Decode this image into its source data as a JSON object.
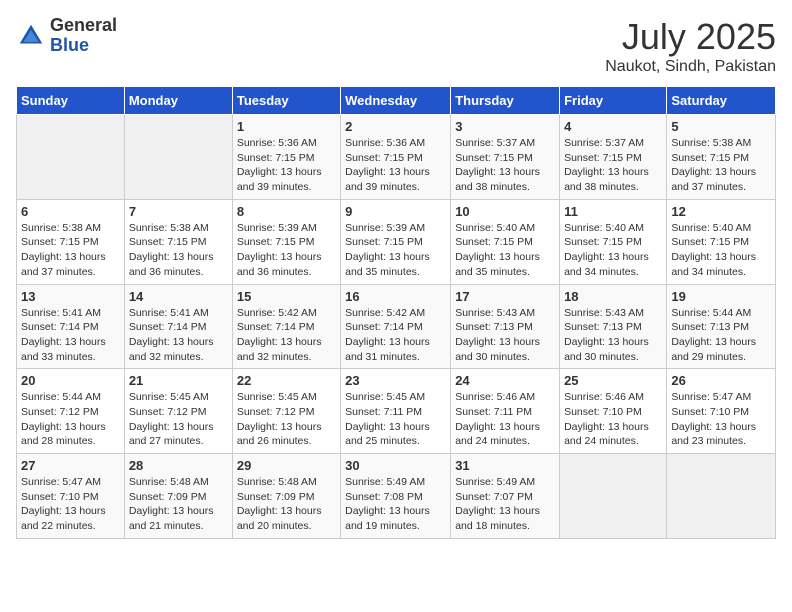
{
  "header": {
    "logo_general": "General",
    "logo_blue": "Blue",
    "month_year": "July 2025",
    "location": "Naukot, Sindh, Pakistan"
  },
  "days_of_week": [
    "Sunday",
    "Monday",
    "Tuesday",
    "Wednesday",
    "Thursday",
    "Friday",
    "Saturday"
  ],
  "weeks": [
    [
      {
        "day": "",
        "info": ""
      },
      {
        "day": "",
        "info": ""
      },
      {
        "day": "1",
        "info": "Sunrise: 5:36 AM\nSunset: 7:15 PM\nDaylight: 13 hours and 39 minutes."
      },
      {
        "day": "2",
        "info": "Sunrise: 5:36 AM\nSunset: 7:15 PM\nDaylight: 13 hours and 39 minutes."
      },
      {
        "day": "3",
        "info": "Sunrise: 5:37 AM\nSunset: 7:15 PM\nDaylight: 13 hours and 38 minutes."
      },
      {
        "day": "4",
        "info": "Sunrise: 5:37 AM\nSunset: 7:15 PM\nDaylight: 13 hours and 38 minutes."
      },
      {
        "day": "5",
        "info": "Sunrise: 5:38 AM\nSunset: 7:15 PM\nDaylight: 13 hours and 37 minutes."
      }
    ],
    [
      {
        "day": "6",
        "info": "Sunrise: 5:38 AM\nSunset: 7:15 PM\nDaylight: 13 hours and 37 minutes."
      },
      {
        "day": "7",
        "info": "Sunrise: 5:38 AM\nSunset: 7:15 PM\nDaylight: 13 hours and 36 minutes."
      },
      {
        "day": "8",
        "info": "Sunrise: 5:39 AM\nSunset: 7:15 PM\nDaylight: 13 hours and 36 minutes."
      },
      {
        "day": "9",
        "info": "Sunrise: 5:39 AM\nSunset: 7:15 PM\nDaylight: 13 hours and 35 minutes."
      },
      {
        "day": "10",
        "info": "Sunrise: 5:40 AM\nSunset: 7:15 PM\nDaylight: 13 hours and 35 minutes."
      },
      {
        "day": "11",
        "info": "Sunrise: 5:40 AM\nSunset: 7:15 PM\nDaylight: 13 hours and 34 minutes."
      },
      {
        "day": "12",
        "info": "Sunrise: 5:40 AM\nSunset: 7:15 PM\nDaylight: 13 hours and 34 minutes."
      }
    ],
    [
      {
        "day": "13",
        "info": "Sunrise: 5:41 AM\nSunset: 7:14 PM\nDaylight: 13 hours and 33 minutes."
      },
      {
        "day": "14",
        "info": "Sunrise: 5:41 AM\nSunset: 7:14 PM\nDaylight: 13 hours and 32 minutes."
      },
      {
        "day": "15",
        "info": "Sunrise: 5:42 AM\nSunset: 7:14 PM\nDaylight: 13 hours and 32 minutes."
      },
      {
        "day": "16",
        "info": "Sunrise: 5:42 AM\nSunset: 7:14 PM\nDaylight: 13 hours and 31 minutes."
      },
      {
        "day": "17",
        "info": "Sunrise: 5:43 AM\nSunset: 7:13 PM\nDaylight: 13 hours and 30 minutes."
      },
      {
        "day": "18",
        "info": "Sunrise: 5:43 AM\nSunset: 7:13 PM\nDaylight: 13 hours and 30 minutes."
      },
      {
        "day": "19",
        "info": "Sunrise: 5:44 AM\nSunset: 7:13 PM\nDaylight: 13 hours and 29 minutes."
      }
    ],
    [
      {
        "day": "20",
        "info": "Sunrise: 5:44 AM\nSunset: 7:12 PM\nDaylight: 13 hours and 28 minutes."
      },
      {
        "day": "21",
        "info": "Sunrise: 5:45 AM\nSunset: 7:12 PM\nDaylight: 13 hours and 27 minutes."
      },
      {
        "day": "22",
        "info": "Sunrise: 5:45 AM\nSunset: 7:12 PM\nDaylight: 13 hours and 26 minutes."
      },
      {
        "day": "23",
        "info": "Sunrise: 5:45 AM\nSunset: 7:11 PM\nDaylight: 13 hours and 25 minutes."
      },
      {
        "day": "24",
        "info": "Sunrise: 5:46 AM\nSunset: 7:11 PM\nDaylight: 13 hours and 24 minutes."
      },
      {
        "day": "25",
        "info": "Sunrise: 5:46 AM\nSunset: 7:10 PM\nDaylight: 13 hours and 24 minutes."
      },
      {
        "day": "26",
        "info": "Sunrise: 5:47 AM\nSunset: 7:10 PM\nDaylight: 13 hours and 23 minutes."
      }
    ],
    [
      {
        "day": "27",
        "info": "Sunrise: 5:47 AM\nSunset: 7:10 PM\nDaylight: 13 hours and 22 minutes."
      },
      {
        "day": "28",
        "info": "Sunrise: 5:48 AM\nSunset: 7:09 PM\nDaylight: 13 hours and 21 minutes."
      },
      {
        "day": "29",
        "info": "Sunrise: 5:48 AM\nSunset: 7:09 PM\nDaylight: 13 hours and 20 minutes."
      },
      {
        "day": "30",
        "info": "Sunrise: 5:49 AM\nSunset: 7:08 PM\nDaylight: 13 hours and 19 minutes."
      },
      {
        "day": "31",
        "info": "Sunrise: 5:49 AM\nSunset: 7:07 PM\nDaylight: 13 hours and 18 minutes."
      },
      {
        "day": "",
        "info": ""
      },
      {
        "day": "",
        "info": ""
      }
    ]
  ]
}
